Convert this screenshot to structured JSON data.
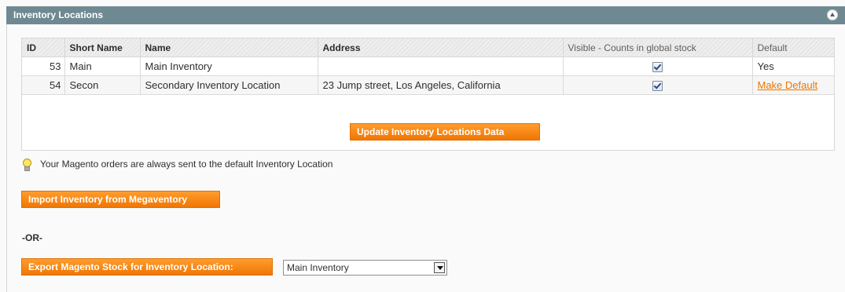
{
  "section": {
    "title": "Inventory Locations"
  },
  "table": {
    "headers": {
      "id": "ID",
      "short_name": "Short Name",
      "name": "Name",
      "address": "Address",
      "visible": "Visible - Counts in global stock",
      "default": "Default"
    },
    "rows": [
      {
        "id": "53",
        "short_name": "Main",
        "name": "Main Inventory",
        "address": "",
        "visible_checked": true,
        "default": "Yes"
      },
      {
        "id": "54",
        "short_name": "Secon",
        "name": "Secondary Inventory Location",
        "address": "23 Jump street, Los Angeles, California",
        "visible_checked": true,
        "default_link": "Make Default"
      }
    ]
  },
  "buttons": {
    "update": "Update Inventory Locations Data",
    "import": "Import Inventory from Megaventory",
    "export": "Export Magento Stock for Inventory Location:"
  },
  "hint": {
    "text": "Your Magento orders are always sent to the default Inventory Location",
    "icon": "lightbulb-icon"
  },
  "separator": "-OR-",
  "export_select": {
    "selected": "Main Inventory"
  },
  "colors": {
    "header_bar": "#6f8992",
    "accent_orange": "#f07603",
    "link": "#ea7601"
  }
}
